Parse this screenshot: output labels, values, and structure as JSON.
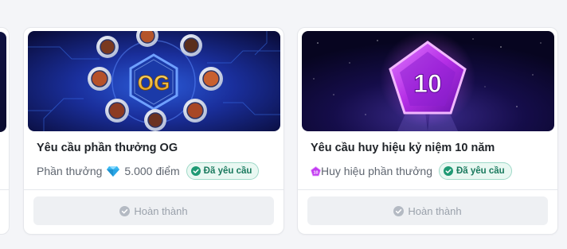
{
  "cards": [
    {
      "title": "Yêu cầu phần thưởng OG",
      "reward_label": "Phần thưởng",
      "reward_icon": "diamond-icon",
      "reward_value": "5.000 điểm",
      "status_badge": "Đã yêu cầu",
      "button_label": "Hoàn thành",
      "image_text": "OG"
    },
    {
      "title": "Yêu cầu huy hiệu kỷ niệm 10 năm",
      "reward_icon": "pentagon-badge-icon",
      "reward_label": "Huy hiệu phần thưởng",
      "status_badge": "Đã yêu cầu",
      "button_label": "Hoàn thành",
      "image_text": "10"
    }
  ],
  "colors": {
    "badge_green": "#1a7a5e",
    "badge_bg": "#e9f8f2",
    "button_bg": "#eef0f3",
    "button_text": "#9aa1ab",
    "accent_purple": "#c23cf0",
    "diamond_blue": "#3ab7f0"
  }
}
